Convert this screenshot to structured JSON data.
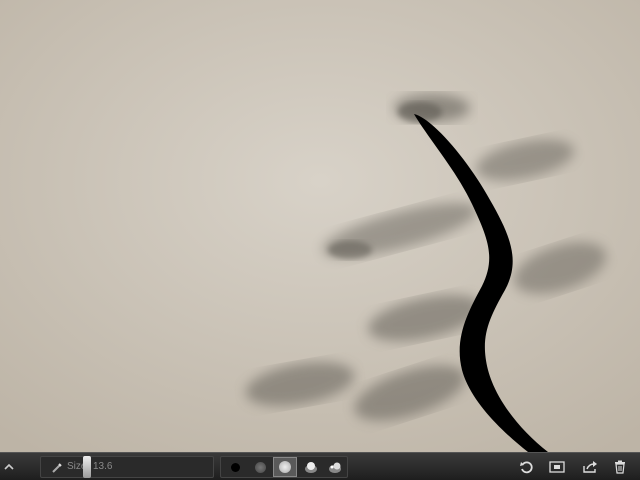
{
  "toolbar": {
    "size_label": "Size",
    "size_value": "13.6",
    "size_fraction": 0.27,
    "brushes": [
      {
        "name": "solid-brush",
        "selected": false
      },
      {
        "name": "soft-brush",
        "selected": false
      },
      {
        "name": "airbrush",
        "selected": true
      },
      {
        "name": "smudge-brush",
        "selected": false
      },
      {
        "name": "eraser-brush",
        "selected": false
      }
    ],
    "actions": [
      "undo-icon",
      "canvas-icon",
      "share-icon",
      "trash-icon"
    ]
  },
  "colors": {
    "paper": "#cfc8bd",
    "ink": "#000000",
    "toolbar": "#2a2a2a"
  }
}
